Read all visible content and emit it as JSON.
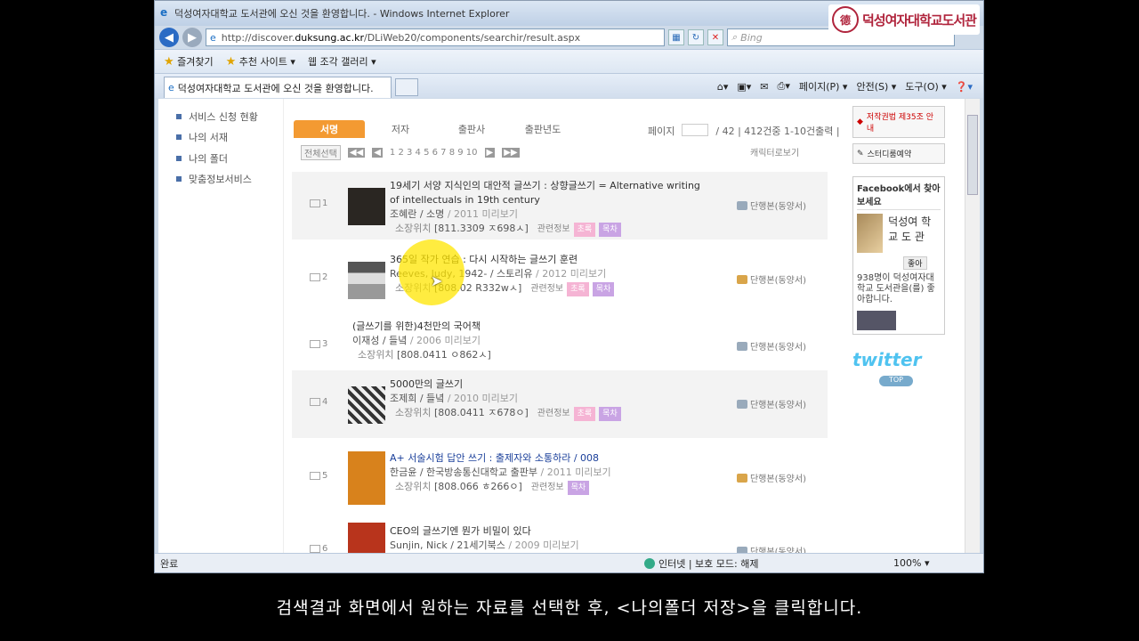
{
  "window": {
    "title": "덕성여자대학교 도서관에 오신 것을 환영합니다. - Windows Internet Explorer",
    "brand": "덕성여자대학교도서관",
    "address_prefix": "http://discover.",
    "address_domain": "duksung.ac.kr",
    "address_path": "/DLiWeb20/components/searchir/result.aspx",
    "search_placeholder": "Bing"
  },
  "favorites_bar": {
    "favorites": "즐겨찾기",
    "suggested": "추천 사이트 ▾",
    "gallery": "웹 조각 갤러리 ▾"
  },
  "tab": {
    "label": "덕성여자대학교 도서관에 오신 것을 환영합니다."
  },
  "command_bar": {
    "page": "페이지(P) ▾",
    "safety": "안전(S) ▾",
    "tools": "도구(O) ▾"
  },
  "left_nav": [
    "서비스 신청 현황",
    "나의 서재",
    "나의 폴더",
    "맞춤정보서비스"
  ],
  "sort_tabs": [
    "서명",
    "저자",
    "출판사",
    "출판년도"
  ],
  "page_info": {
    "label": "페이지",
    "count": "/ 42 | 412건중 1-10건출력 |"
  },
  "toolbar": {
    "select_all": "전체선택",
    "pages": "1 2 3 4 5 6 7 8 9 10",
    "view": "캐릭터로보기"
  },
  "results": [
    {
      "num": "1",
      "title": "19세기 서양 지식인의 대안적 글쓰기 : 상향글쓰기 = Alternative writing of intellectuals in 19th century",
      "author": "조혜란 / 소명",
      "year": "/ 2011 미리보기",
      "location": "[811.3309 ㅈ698ㅅ]",
      "badges": [
        "초록",
        "목차"
      ],
      "tag": "단행본(동양서)"
    },
    {
      "num": "2",
      "title": "365일 작가 연습 : 다시 시작하는 글쓰기 훈련",
      "author": "Reeves, Judy, 1942- / 스토리유",
      "year": "/ 2012 미리보기",
      "location": "[808.02 R332wㅅ]",
      "badges": [
        "초록",
        "목차"
      ],
      "tag": "단행본(동양서)"
    },
    {
      "num": "3",
      "title": "(글쓰기를 위한)4천만의 국어책",
      "author": "이재성 / 들녘",
      "year": "/ 2006 미리보기",
      "location": "[808.0411 ㅇ862ㅅ]",
      "badges": [],
      "tag": "단행본(동양서)"
    },
    {
      "num": "4",
      "title": "5000만의 글쓰기",
      "author": "조제희 / 들녘",
      "year": "/ 2010 미리보기",
      "location": "[808.0411 ㅈ678ㅇ]",
      "badges": [
        "초록",
        "목차"
      ],
      "tag": "단행본(동양서)"
    },
    {
      "num": "5",
      "title": "A+ 서술시험 답안 쓰기 : 출제자와 소통하라 / 008",
      "author": "한금윤 / 한국방송통신대학교 출판부",
      "year": "/ 2011 미리보기",
      "location": "[808.066 ㅎ266ㅇ]",
      "badges": [
        "목차"
      ],
      "tag": "단행본(동양서)"
    },
    {
      "num": "6",
      "title": "CEO의 글쓰기엔 뭔가 비밀이 있다",
      "author": "Sunjin, Nick / 21세기북스",
      "year": "/ 2009 미리보기",
      "location": "",
      "badges": [],
      "tag": "단행본(동양서)"
    }
  ],
  "result_labels": {
    "location_label": "소장위치",
    "info_link": "관련정보"
  },
  "right_col": {
    "btn1": "저작권법 제35조 안내",
    "btn2": "스터디룸예약",
    "fb_title": "Facebook에서 찾아보세요",
    "fb_name": "덕성여 학교 도 관",
    "fb_like": "좋아",
    "fb_foot": "938명이 덕성여자대학교 도서관을(를) 좋아합니다.",
    "twitter": "twitter",
    "tw_btn": "TOP"
  },
  "status": {
    "done": "완료",
    "zone": "인터넷 | 보호 모드: 해제",
    "zoom": "100% ▾"
  },
  "subtitle": "검색결과 화면에서 원하는 자료를 선택한 후, <나의폴더 저장>을 클릭합니다."
}
